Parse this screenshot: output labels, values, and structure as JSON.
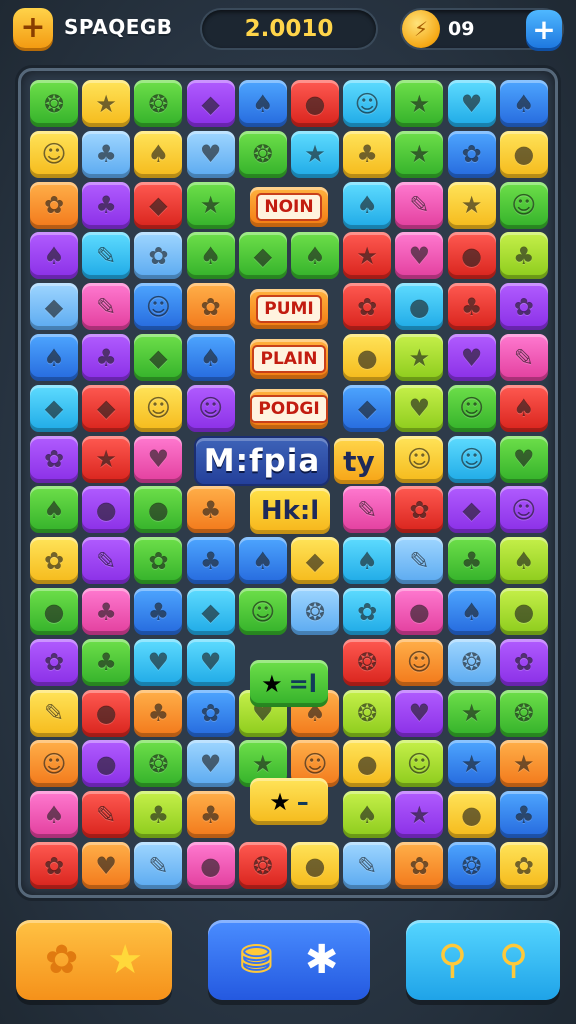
{
  "header": {
    "brand_icon": "plus-icon",
    "brand_glyph": "+",
    "brand_name": "SPAQEGB",
    "score": "2.0010",
    "coin_icon": "coin-icon",
    "coin_glyph": "⚡",
    "coins": "09",
    "add_icon": "plus-icon",
    "add_glyph": "+"
  },
  "board": {
    "label_tiles": [
      "NOIN",
      "PUMI",
      "PLAIN",
      "PODGI"
    ],
    "banner_text": "M:fpia",
    "banner_side_text": "ty",
    "side_label": "Hk:l",
    "row12_wide_text": "=l",
    "row14_wide_text": "–"
  },
  "footer": {
    "left": {
      "icons": [
        "flower-icon",
        "star-icon"
      ],
      "glyphs": [
        "✿",
        "★"
      ]
    },
    "middle": {
      "icons": [
        "bucket-icon",
        "gear-icon"
      ],
      "glyphs": [
        "⛃",
        "✱"
      ]
    },
    "right": {
      "icons": [
        "search-icon",
        "location-icon"
      ],
      "glyphs": [
        "⚲",
        "⚲"
      ]
    }
  },
  "colors": {
    "background": "#2b3847",
    "score_text": "#ffd54a",
    "accent_blue": "#1e78e0",
    "accent_orange": "#f5911a"
  }
}
